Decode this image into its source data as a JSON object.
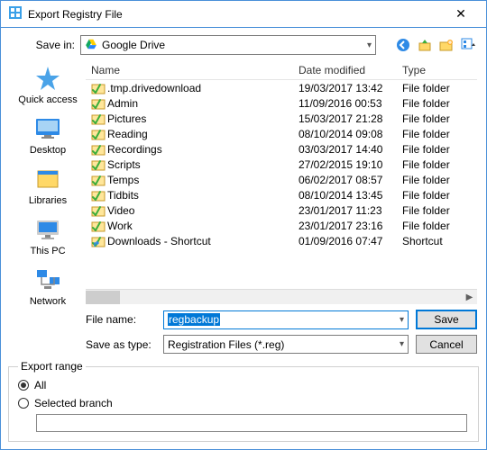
{
  "window": {
    "title": "Export Registry File"
  },
  "savein": {
    "label": "Save in:",
    "location": "Google Drive"
  },
  "columns": {
    "name": "Name",
    "date": "Date modified",
    "type": "Type"
  },
  "files": [
    {
      "name": ".tmp.drivedownload",
      "date": "19/03/2017 13:42",
      "type": "File folder",
      "icon": "folder"
    },
    {
      "name": "Admin",
      "date": "11/09/2016 00:53",
      "type": "File folder",
      "icon": "folder"
    },
    {
      "name": "Pictures",
      "date": "15/03/2017 21:28",
      "type": "File folder",
      "icon": "folder"
    },
    {
      "name": "Reading",
      "date": "08/10/2014 09:08",
      "type": "File folder",
      "icon": "folder"
    },
    {
      "name": "Recordings",
      "date": "03/03/2017 14:40",
      "type": "File folder",
      "icon": "folder"
    },
    {
      "name": "Scripts",
      "date": "27/02/2015 19:10",
      "type": "File folder",
      "icon": "folder"
    },
    {
      "name": "Temps",
      "date": "06/02/2017 08:57",
      "type": "File folder",
      "icon": "folder"
    },
    {
      "name": "Tidbits",
      "date": "08/10/2014 13:45",
      "type": "File folder",
      "icon": "folder"
    },
    {
      "name": "Video",
      "date": "23/01/2017 11:23",
      "type": "File folder",
      "icon": "folder"
    },
    {
      "name": "Work",
      "date": "23/01/2017 23:16",
      "type": "File folder",
      "icon": "folder"
    },
    {
      "name": "Downloads - Shortcut",
      "date": "01/09/2016 07:47",
      "type": "Shortcut",
      "icon": "shortcut"
    }
  ],
  "sidebar": {
    "quick": "Quick access",
    "desktop": "Desktop",
    "libraries": "Libraries",
    "thispc": "This PC",
    "network": "Network"
  },
  "filename_label": "File name:",
  "filename_value": "regbackup",
  "savetype_label": "Save as type:",
  "savetype_value": "Registration Files (*.reg)",
  "buttons": {
    "save": "Save",
    "cancel": "Cancel"
  },
  "export": {
    "legend": "Export range",
    "all": "All",
    "selected": "Selected branch",
    "branch_value": ""
  },
  "colors": {
    "accent": "#0078d7",
    "border": "#4a90d9"
  }
}
